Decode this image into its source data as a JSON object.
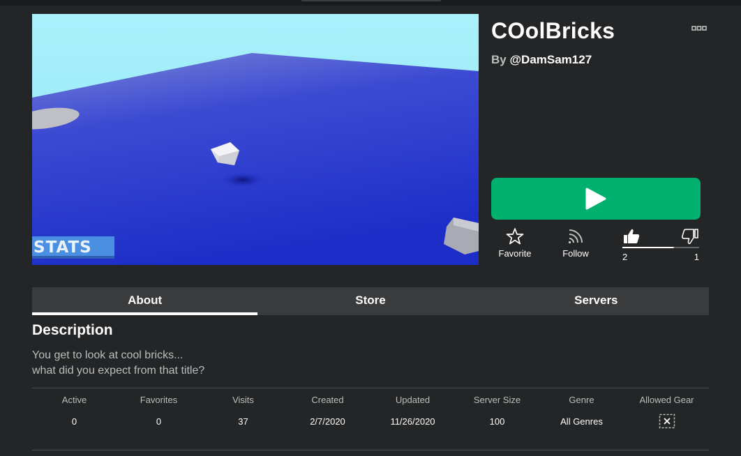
{
  "game": {
    "title": "COolBricks",
    "by_prefix": "By ",
    "creator": "@DamSam127"
  },
  "thumbnail": {
    "overlay_text": "STATS"
  },
  "actions": {
    "favorite_label": "Favorite",
    "follow_label": "Follow",
    "upvotes": "2",
    "downvotes": "1",
    "upvote_fraction": 0.67
  },
  "tabs": [
    {
      "label": "About",
      "active": true
    },
    {
      "label": "Store",
      "active": false
    },
    {
      "label": "Servers",
      "active": false
    }
  ],
  "description": {
    "heading": "Description",
    "lines": [
      "You get to look at cool bricks...",
      "what did you expect from that title?"
    ]
  },
  "stats": [
    {
      "header": "Active",
      "value": "0"
    },
    {
      "header": "Favorites",
      "value": "0"
    },
    {
      "header": "Visits",
      "value": "37"
    },
    {
      "header": "Created",
      "value": "2/7/2020"
    },
    {
      "header": "Updated",
      "value": "11/26/2020"
    },
    {
      "header": "Server Size",
      "value": "100"
    },
    {
      "header": "Genre",
      "value": "All Genres"
    },
    {
      "header": "Allowed Gear",
      "value": ""
    }
  ],
  "colors": {
    "background": "#232527",
    "play": "#00b06f",
    "tab_bar": "#393b3d",
    "text_secondary": "#bdbebe"
  }
}
